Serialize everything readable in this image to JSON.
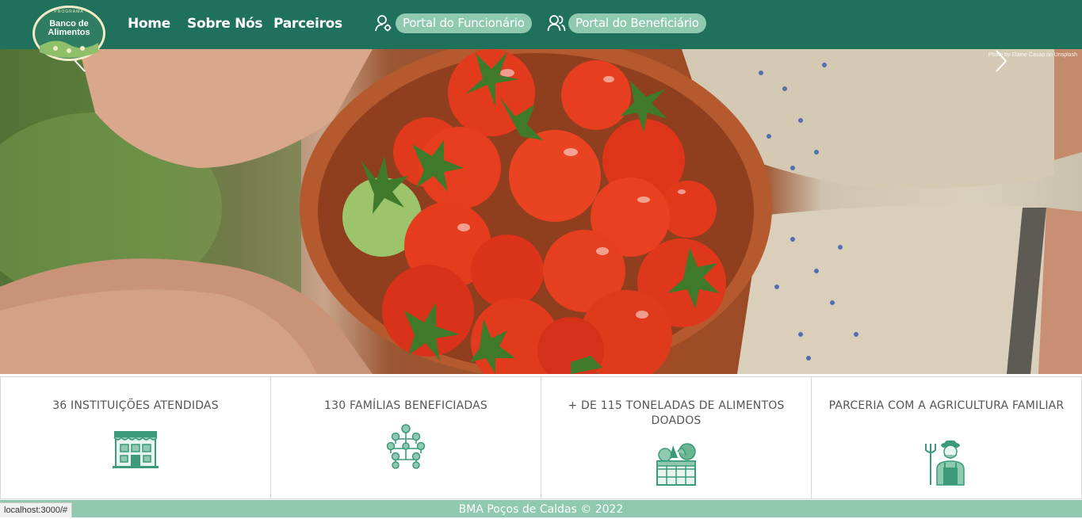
{
  "header": {
    "logo": {
      "top_text": "PROGRAMA",
      "line1": "Banco de",
      "line2": "Alimentos"
    },
    "nav": [
      {
        "label": "Home"
      },
      {
        "label": "Sobre Nós"
      },
      {
        "label": "Parceiros"
      }
    ],
    "portals": [
      {
        "label": "Portal do Funcionário",
        "icon": "user-gear-icon"
      },
      {
        "label": "Portal do Beneficiário",
        "icon": "users-icon"
      }
    ]
  },
  "hero": {
    "credit": "Photo by Elaine Casap on Unsplash",
    "prev_icon": "chevron-left-icon",
    "next_icon": "chevron-right-icon"
  },
  "stats": [
    {
      "title": "36 INSTITUIÇÕES ATENDIDAS",
      "icon": "building-icon"
    },
    {
      "title": "130 FAMÍLIAS BENEFICIADAS",
      "icon": "family-tree-icon"
    },
    {
      "title": "+ DE 115 TONELADAS DE ALIMENTOS DOADOS",
      "icon": "vegetable-crate-icon"
    },
    {
      "title": "PARCERIA COM A AGRICULTURA FAMILIAR",
      "icon": "farmer-icon"
    }
  ],
  "footer": {
    "text": "BMA Poços de Caldas © 2022"
  },
  "status_url": "localhost:3000/#",
  "colors": {
    "header": "#20715b",
    "accent": "#8fc9b0",
    "icon_green": "#3a9a7a"
  }
}
